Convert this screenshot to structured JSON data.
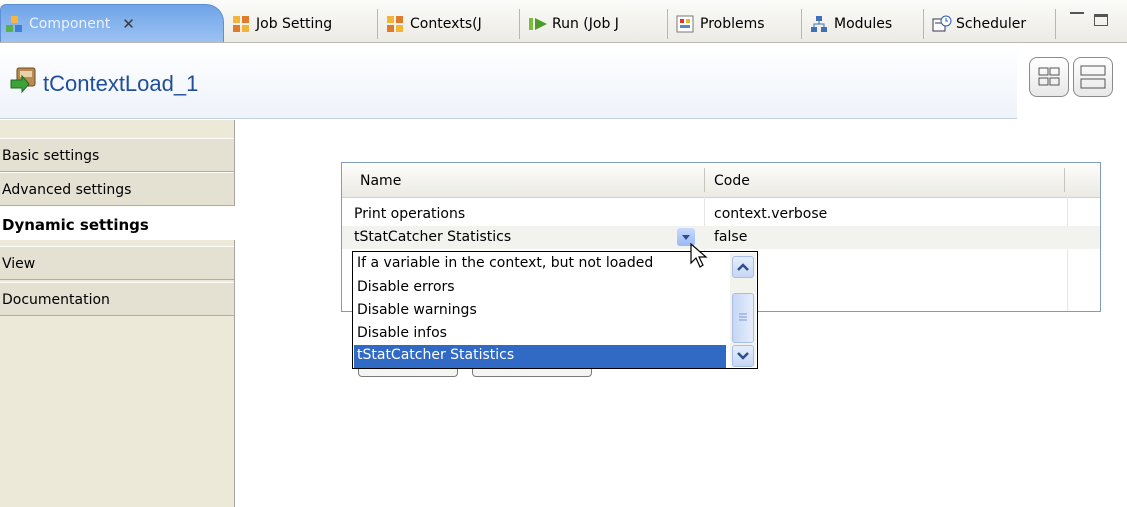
{
  "tabs": [
    {
      "label": "Component",
      "icon": "component-icon",
      "active": true
    },
    {
      "label": "Job Setting",
      "icon": "job-setting-icon"
    },
    {
      "label": "Contexts(J",
      "icon": "contexts-icon"
    },
    {
      "label": "Run (Job J",
      "icon": "run-icon"
    },
    {
      "label": "Problems",
      "icon": "problems-icon"
    },
    {
      "label": "Modules",
      "icon": "modules-icon"
    },
    {
      "label": "Scheduler",
      "icon": "scheduler-icon"
    }
  ],
  "window_controls": [
    "minimize-icon",
    "maximize-icon"
  ],
  "header": {
    "title": "tContextLoad_1",
    "icon": "tcontextload-icon"
  },
  "sidenav": {
    "items": [
      {
        "label": "Basic settings"
      },
      {
        "label": "Advanced settings"
      },
      {
        "label": "Dynamic settings",
        "active": true
      },
      {
        "label": "View"
      },
      {
        "label": "Documentation"
      }
    ]
  },
  "table": {
    "columns": [
      "Name",
      "Code"
    ],
    "rows": [
      {
        "name": "Print operations",
        "code": "context.verbose"
      },
      {
        "name": "tStatCatcher Statistics",
        "code": "false"
      }
    ]
  },
  "dropdown": {
    "options": [
      "If a variable in the context, but not loaded",
      "Disable errors",
      "Disable warnings",
      "Disable infos",
      "tStatCatcher Statistics"
    ],
    "selected_index": 4
  },
  "colors": {
    "active_tab": "#7aaeee",
    "title_text": "#1e4e9c",
    "selection": "#316ac5",
    "nav_background": "#ece9d8"
  }
}
